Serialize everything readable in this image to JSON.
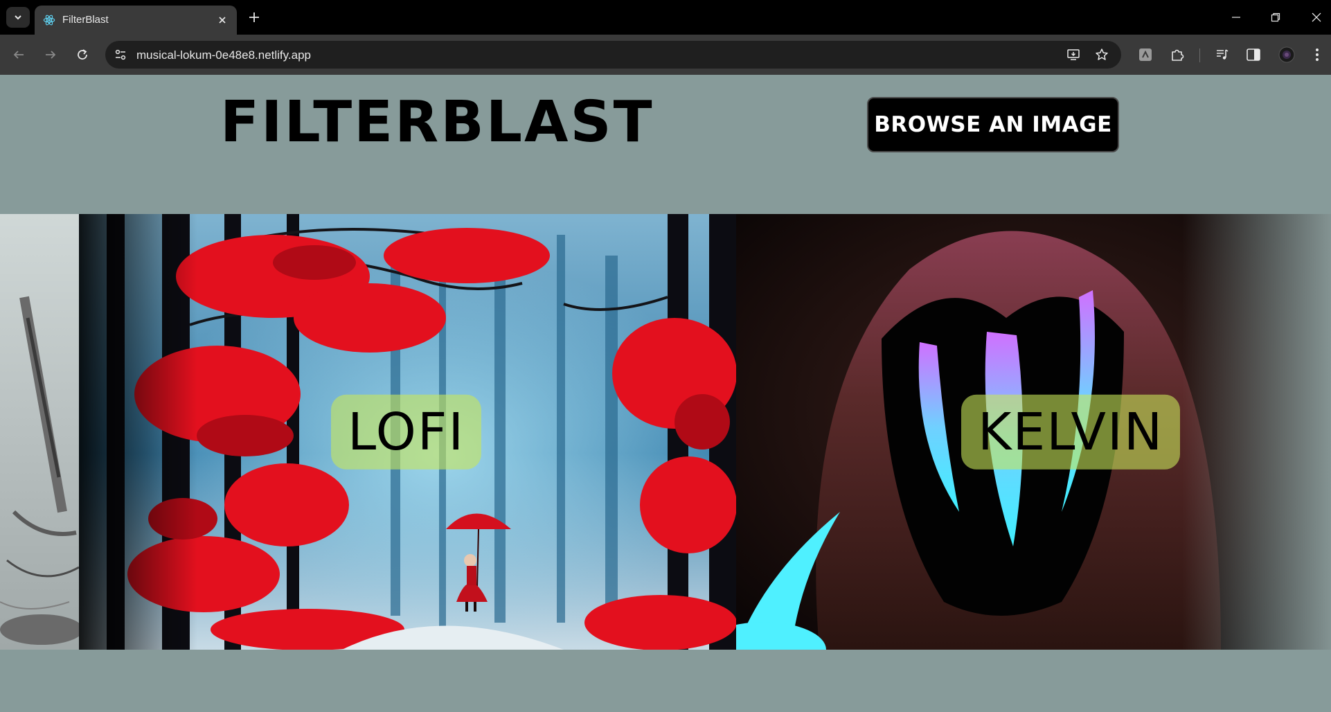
{
  "browser": {
    "tab_title": "FilterBlast",
    "url": "musical-lokum-0e48e8.netlify.app"
  },
  "header": {
    "logo": "FILTERBLAST",
    "browse_button": "BROWSE AN IMAGE"
  },
  "carousel": {
    "slides": [
      {
        "label": "LOFI",
        "image": "red-forest-umbrella-girl"
      },
      {
        "label": "KELVIN",
        "image": "hooded-figure-neon"
      }
    ],
    "partial_left_image": "grayscale-sketch"
  },
  "icons": [
    "tab-search-icon",
    "react-favicon-icon",
    "close-icon",
    "plus-icon",
    "minimize-icon",
    "restore-icon",
    "window-close-icon",
    "back-arrow-icon",
    "forward-arrow-icon",
    "reload-icon",
    "site-info-icon",
    "install-app-icon",
    "bookmark-star-icon",
    "extension-icon",
    "puzzle-icon",
    "media-control-icon",
    "side-panel-icon",
    "profile-avatar-icon",
    "kebab-menu-icon"
  ]
}
